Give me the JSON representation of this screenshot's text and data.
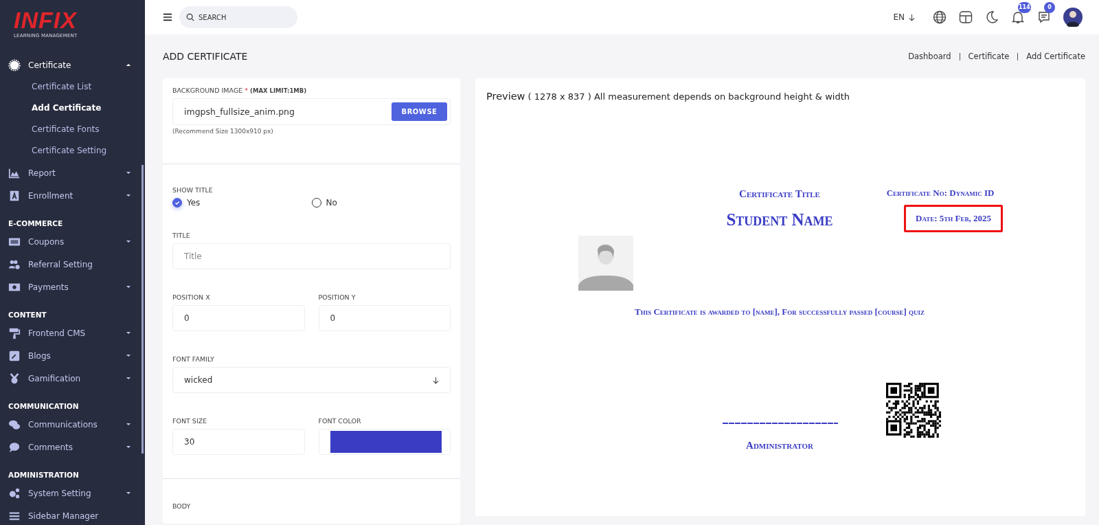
{
  "sidebar": {
    "logo": {
      "title": "INFIX",
      "subtitle": "LEARNING MANAGEMENT"
    },
    "sections": [
      {
        "items": [
          {
            "label": "Certificate",
            "expandable": true,
            "expanded": true,
            "children": [
              {
                "label": "Certificate List",
                "selected": false
              },
              {
                "label": "Add Certificate",
                "selected": true
              },
              {
                "label": "Certificate Fonts",
                "selected": false
              },
              {
                "label": "Certificate Setting",
                "selected": false
              }
            ]
          },
          {
            "label": "Report",
            "expandable": true,
            "expanded": false
          },
          {
            "label": "Enrollment",
            "expandable": true,
            "expanded": false
          }
        ]
      },
      {
        "heading": "E-COMMERCE",
        "items": [
          {
            "label": "Coupons",
            "expandable": true,
            "expanded": false
          },
          {
            "label": "Referral Setting",
            "expandable": false
          },
          {
            "label": "Payments",
            "expandable": true,
            "expanded": false
          }
        ]
      },
      {
        "heading": "CONTENT",
        "items": [
          {
            "label": "Frontend CMS",
            "expandable": true,
            "expanded": false
          },
          {
            "label": "Blogs",
            "expandable": true,
            "expanded": false
          },
          {
            "label": "Gamification",
            "expandable": true,
            "expanded": false
          }
        ]
      },
      {
        "heading": "COMMUNICATION",
        "items": [
          {
            "label": "Communications",
            "expandable": true,
            "expanded": false
          },
          {
            "label": "Comments",
            "expandable": true,
            "expanded": false
          }
        ]
      },
      {
        "heading": "ADMINISTRATION",
        "items": [
          {
            "label": "System Setting",
            "expandable": true,
            "expanded": false
          },
          {
            "label": "Sidebar Manager",
            "expandable": false
          }
        ]
      }
    ]
  },
  "topbar": {
    "search": {
      "placeholder": "SEARCH"
    },
    "language": "EN",
    "notifications": "114",
    "messages": "0"
  },
  "page": {
    "title": "ADD CERTIFICATE",
    "breadcrumb": [
      "Dashboard",
      "Certificate",
      "Add Certificate"
    ]
  },
  "form": {
    "background_image": {
      "label": "BACKGROUND IMAGE",
      "required": "*",
      "note": "(MAX LIMIT:1MB)",
      "value": "imgpsh_fullsize_anim.png",
      "button": "BROWSE",
      "hint": "(Recommend Size 1300x910 px)"
    },
    "show_title": {
      "label": "SHOW TITLE",
      "options": [
        {
          "label": "Yes",
          "selected": true
        },
        {
          "label": "No",
          "selected": false
        }
      ]
    },
    "title": {
      "label": "TITLE",
      "placeholder": "Title"
    },
    "position_x": {
      "label": "POSITION X",
      "value": "0"
    },
    "position_y": {
      "label": "POSITION Y",
      "value": "0"
    },
    "font_family": {
      "label": "FONT FAMILY",
      "value": "wicked"
    },
    "font_size": {
      "label": "FONT SIZE",
      "value": "30"
    },
    "font_color": {
      "label": "FONT COLOR",
      "color": "#3a3cc4"
    },
    "body": {
      "label": "BODY"
    }
  },
  "preview": {
    "title": "Preview",
    "size": "( 1278 x 837 )",
    "note": "All measurement depends on background height & width",
    "certificate": {
      "title": "Certificate Title",
      "number": "Certificate No: Dynamic ID",
      "student_name": "Student Name",
      "date": "Date: 5th Feb, 2025",
      "date_highlighted": true,
      "body": "This Certificate is awarded to [name], For successfully passed [course] quiz",
      "signature": "Administrator"
    }
  }
}
